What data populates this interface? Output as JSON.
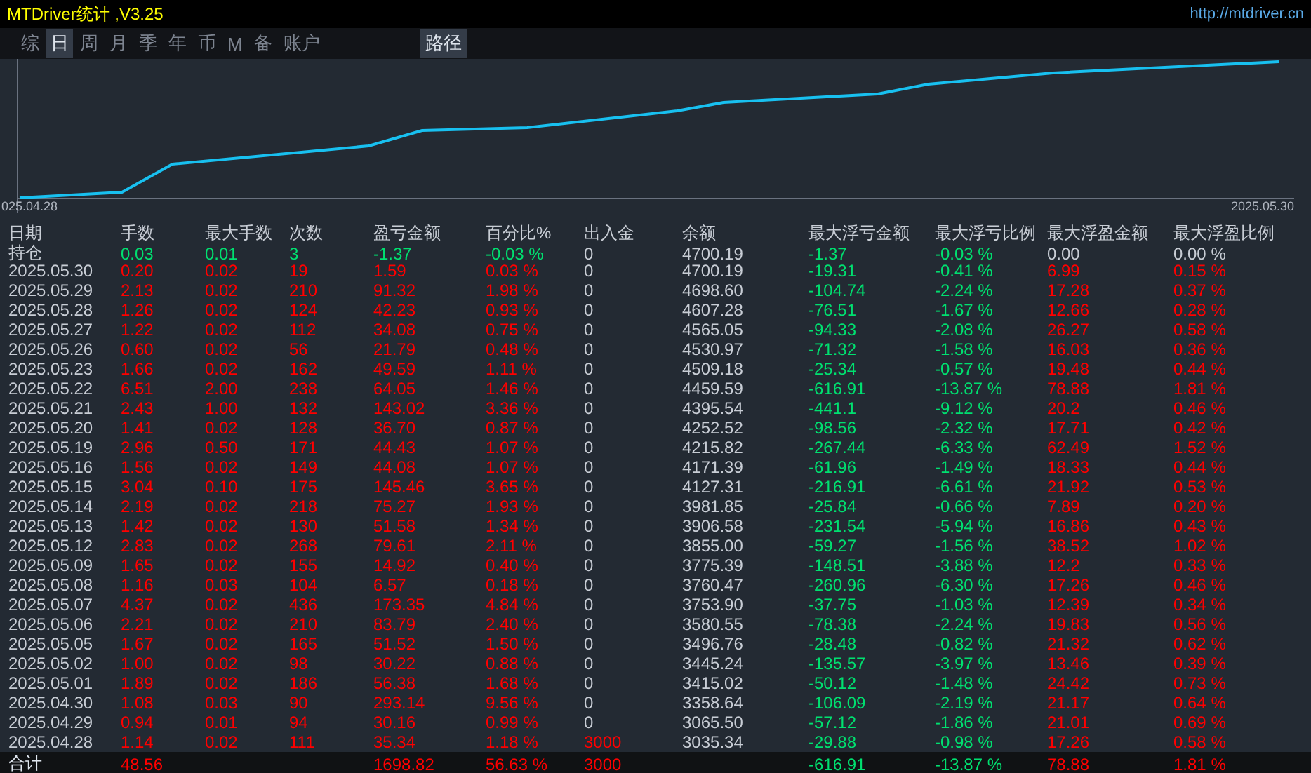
{
  "window": {
    "title": "MTDriver统计 ,V3.25",
    "link": "http://mtdriver.cn"
  },
  "tabs": [
    {
      "label": "综",
      "selected": false
    },
    {
      "label": "日",
      "selected": true
    },
    {
      "label": "周",
      "selected": false
    },
    {
      "label": "月",
      "selected": false
    },
    {
      "label": "季",
      "selected": false
    },
    {
      "label": "年",
      "selected": false
    },
    {
      "label": "币",
      "selected": false
    },
    {
      "label": "M",
      "selected": false
    },
    {
      "label": "备",
      "selected": false
    },
    {
      "label": "账户",
      "selected": false
    }
  ],
  "path_button": "路径",
  "chart": {
    "start_label": "025.04.28",
    "end_label": "2025.05.30"
  },
  "table": {
    "columns": [
      "日期",
      "手数",
      "最大手数",
      "次数",
      "盈亏金额",
      "百分比%",
      "出入金",
      "余额",
      "最大浮亏金额",
      "最大浮亏比例",
      "最大浮盈金额",
      "最大浮盈比例"
    ],
    "rows": [
      {
        "kind": "position",
        "cells": [
          "持仓",
          "0.03",
          "0.01",
          "3",
          "-1.37",
          "-0.03 %",
          "0",
          "4700.19",
          "-1.37",
          "-0.03 %",
          "0.00",
          "0.00 %"
        ]
      },
      {
        "kind": "day",
        "cells": [
          "2025.05.30",
          "0.20",
          "0.02",
          "19",
          "1.59",
          "0.03 %",
          "0",
          "4700.19",
          "-19.31",
          "-0.41 %",
          "6.99",
          "0.15 %"
        ]
      },
      {
        "kind": "day",
        "cells": [
          "2025.05.29",
          "2.13",
          "0.02",
          "210",
          "91.32",
          "1.98 %",
          "0",
          "4698.60",
          "-104.74",
          "-2.24 %",
          "17.28",
          "0.37 %"
        ]
      },
      {
        "kind": "day",
        "cells": [
          "2025.05.28",
          "1.26",
          "0.02",
          "124",
          "42.23",
          "0.93 %",
          "0",
          "4607.28",
          "-76.51",
          "-1.67 %",
          "12.66",
          "0.28 %"
        ]
      },
      {
        "kind": "day",
        "cells": [
          "2025.05.27",
          "1.22",
          "0.02",
          "112",
          "34.08",
          "0.75 %",
          "0",
          "4565.05",
          "-94.33",
          "-2.08 %",
          "26.27",
          "0.58 %"
        ]
      },
      {
        "kind": "day",
        "cells": [
          "2025.05.26",
          "0.60",
          "0.02",
          "56",
          "21.79",
          "0.48 %",
          "0",
          "4530.97",
          "-71.32",
          "-1.58 %",
          "16.03",
          "0.36 %"
        ]
      },
      {
        "kind": "day",
        "cells": [
          "2025.05.23",
          "1.66",
          "0.02",
          "162",
          "49.59",
          "1.11 %",
          "0",
          "4509.18",
          "-25.34",
          "-0.57 %",
          "19.48",
          "0.44 %"
        ]
      },
      {
        "kind": "day",
        "cells": [
          "2025.05.22",
          "6.51",
          "2.00",
          "238",
          "64.05",
          "1.46 %",
          "0",
          "4459.59",
          "-616.91",
          "-13.87 %",
          "78.88",
          "1.81 %"
        ]
      },
      {
        "kind": "day",
        "cells": [
          "2025.05.21",
          "2.43",
          "1.00",
          "132",
          "143.02",
          "3.36 %",
          "0",
          "4395.54",
          "-441.1",
          "-9.12 %",
          "20.2",
          "0.46 %"
        ]
      },
      {
        "kind": "day",
        "cells": [
          "2025.05.20",
          "1.41",
          "0.02",
          "128",
          "36.70",
          "0.87 %",
          "0",
          "4252.52",
          "-98.56",
          "-2.32 %",
          "17.71",
          "0.42 %"
        ]
      },
      {
        "kind": "day",
        "cells": [
          "2025.05.19",
          "2.96",
          "0.50",
          "171",
          "44.43",
          "1.07 %",
          "0",
          "4215.82",
          "-267.44",
          "-6.33 %",
          "62.49",
          "1.52 %"
        ]
      },
      {
        "kind": "day",
        "cells": [
          "2025.05.16",
          "1.56",
          "0.02",
          "149",
          "44.08",
          "1.07 %",
          "0",
          "4171.39",
          "-61.96",
          "-1.49 %",
          "18.33",
          "0.44 %"
        ]
      },
      {
        "kind": "day",
        "cells": [
          "2025.05.15",
          "3.04",
          "0.10",
          "175",
          "145.46",
          "3.65 %",
          "0",
          "4127.31",
          "-216.91",
          "-6.61 %",
          "21.92",
          "0.53 %"
        ]
      },
      {
        "kind": "day",
        "cells": [
          "2025.05.14",
          "2.19",
          "0.02",
          "218",
          "75.27",
          "1.93 %",
          "0",
          "3981.85",
          "-25.84",
          "-0.66 %",
          "7.89",
          "0.20 %"
        ]
      },
      {
        "kind": "day",
        "cells": [
          "2025.05.13",
          "1.42",
          "0.02",
          "130",
          "51.58",
          "1.34 %",
          "0",
          "3906.58",
          "-231.54",
          "-5.94 %",
          "16.86",
          "0.43 %"
        ]
      },
      {
        "kind": "day",
        "cells": [
          "2025.05.12",
          "2.83",
          "0.02",
          "268",
          "79.61",
          "2.11 %",
          "0",
          "3855.00",
          "-59.27",
          "-1.56 %",
          "38.52",
          "1.02 %"
        ]
      },
      {
        "kind": "day",
        "cells": [
          "2025.05.09",
          "1.65",
          "0.02",
          "155",
          "14.92",
          "0.40 %",
          "0",
          "3775.39",
          "-148.51",
          "-3.88 %",
          "12.2",
          "0.33 %"
        ]
      },
      {
        "kind": "day",
        "cells": [
          "2025.05.08",
          "1.16",
          "0.03",
          "104",
          "6.57",
          "0.18 %",
          "0",
          "3760.47",
          "-260.96",
          "-6.30 %",
          "17.26",
          "0.46 %"
        ]
      },
      {
        "kind": "day",
        "cells": [
          "2025.05.07",
          "4.37",
          "0.02",
          "436",
          "173.35",
          "4.84 %",
          "0",
          "3753.90",
          "-37.75",
          "-1.03 %",
          "12.39",
          "0.34 %"
        ]
      },
      {
        "kind": "day",
        "cells": [
          "2025.05.06",
          "2.21",
          "0.02",
          "210",
          "83.79",
          "2.40 %",
          "0",
          "3580.55",
          "-78.38",
          "-2.24 %",
          "19.83",
          "0.56 %"
        ]
      },
      {
        "kind": "day",
        "cells": [
          "2025.05.05",
          "1.67",
          "0.02",
          "165",
          "51.52",
          "1.50 %",
          "0",
          "3496.76",
          "-28.48",
          "-0.82 %",
          "21.32",
          "0.62 %"
        ]
      },
      {
        "kind": "day",
        "cells": [
          "2025.05.02",
          "1.00",
          "0.02",
          "98",
          "30.22",
          "0.88 %",
          "0",
          "3445.24",
          "-135.57",
          "-3.97 %",
          "13.46",
          "0.39 %"
        ]
      },
      {
        "kind": "day",
        "cells": [
          "2025.05.01",
          "1.89",
          "0.02",
          "186",
          "56.38",
          "1.68 %",
          "0",
          "3415.02",
          "-50.12",
          "-1.48 %",
          "24.42",
          "0.73 %"
        ]
      },
      {
        "kind": "day",
        "cells": [
          "2025.04.30",
          "1.08",
          "0.03",
          "90",
          "293.14",
          "9.56 %",
          "0",
          "3358.64",
          "-106.09",
          "-2.19 %",
          "21.17",
          "0.64 %"
        ]
      },
      {
        "kind": "day",
        "cells": [
          "2025.04.29",
          "0.94",
          "0.01",
          "94",
          "30.16",
          "0.99 %",
          "0",
          "3065.50",
          "-57.12",
          "-1.86 %",
          "21.01",
          "0.69 %"
        ]
      },
      {
        "kind": "deposit",
        "cells": [
          "2025.04.28",
          "1.14",
          "0.02",
          "111",
          "35.34",
          "1.18 %",
          "3000",
          "3035.34",
          "-29.88",
          "-0.98 %",
          "17.26",
          "0.58 %"
        ]
      }
    ],
    "total": {
      "kind": "total",
      "cells": [
        "合计",
        "48.56",
        null,
        null,
        "1698.82",
        "56.63 %",
        "3000",
        null,
        "-616.91",
        "-13.87 %",
        "78.88",
        "1.81 %"
      ]
    }
  }
}
